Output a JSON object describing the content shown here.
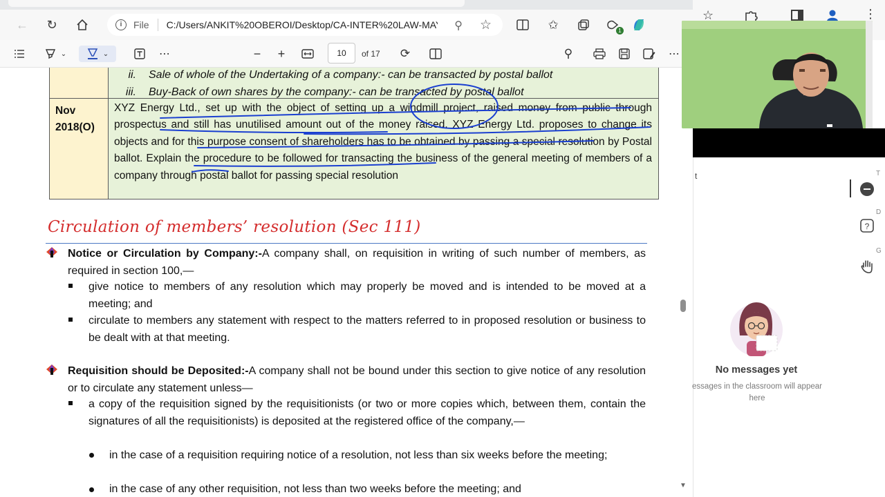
{
  "browser": {
    "url_scheme": "File",
    "url": "C:/Users/ANKIT%20OBEROI/Desktop/CA-INTER%20LAW-MAY...",
    "badge_count": "1"
  },
  "pdf_toolbar": {
    "current_page": "10",
    "page_of": "of 17"
  },
  "doc": {
    "roman_items": [
      {
        "num": "ii.",
        "text": "Sale of whole of the Undertaking of a company:- can be transacted by postal ballot"
      },
      {
        "num": "iii.",
        "text": "Buy-Back of own shares by the company:- can be transacted by postal ballot"
      }
    ],
    "question": {
      "year": "Nov 2018(O)",
      "text": "XYZ Energy Ltd., set up with the object of setting up a windmill project, raised money from public through prospectus and still has unutilised amount out of the money raised. XYZ Energy Ltd. proposes to change its objects and for this purpose consent of shareholders has to be obtained by passing a special resolution by Postal ballot. Explain the procedure to be followed for transacting the business of the general meeting of members of a company through postal ballot for passing special resolution"
    },
    "heading": "Circulation of members’ resolution (Sec 111)",
    "section1": {
      "bold": "Notice or Circulation by Company:-",
      "text": "A company shall, on requisition in writing of such number of members, as required in section 100,—",
      "bullets": [
        "give notice to members of any resolution which may properly be moved and is intended to be moved at a meeting; and",
        "circulate to members any statement with respect to the matters referred to in proposed resolution or business to be dealt with at that meeting."
      ]
    },
    "section2": {
      "bold": "Requisition should be Deposited:-",
      "text": "A company shall not be bound under this section to give notice of any resolution or to circulate any statement unless—",
      "bullet": "a copy of the requisition signed by the requisitionists (or two or more copies which, between them, contain the signatures of all the requisitionists) is deposited at the registered office of the company,—",
      "subbullets": [
        "in the case of a requisition requiring notice of a resolution, not less than six weeks before the meeting;",
        "in the case of any other requisition, not less than two weeks before the meeting; and"
      ]
    }
  },
  "side_panel": {
    "partial_text": "t",
    "rail_letters": [
      "T",
      "D",
      "G"
    ],
    "empty_title": "No messages yet",
    "empty_sub_line1": "essages in the classroom will appear",
    "empty_sub_line2": "here"
  },
  "colors": {
    "heading_red": "#d42d2d",
    "ink_blue": "#1a3fd0",
    "year_cell": "#fdf3cf",
    "question_cell": "#e7f2d9",
    "webcam_wall": "#9fcf7e"
  }
}
